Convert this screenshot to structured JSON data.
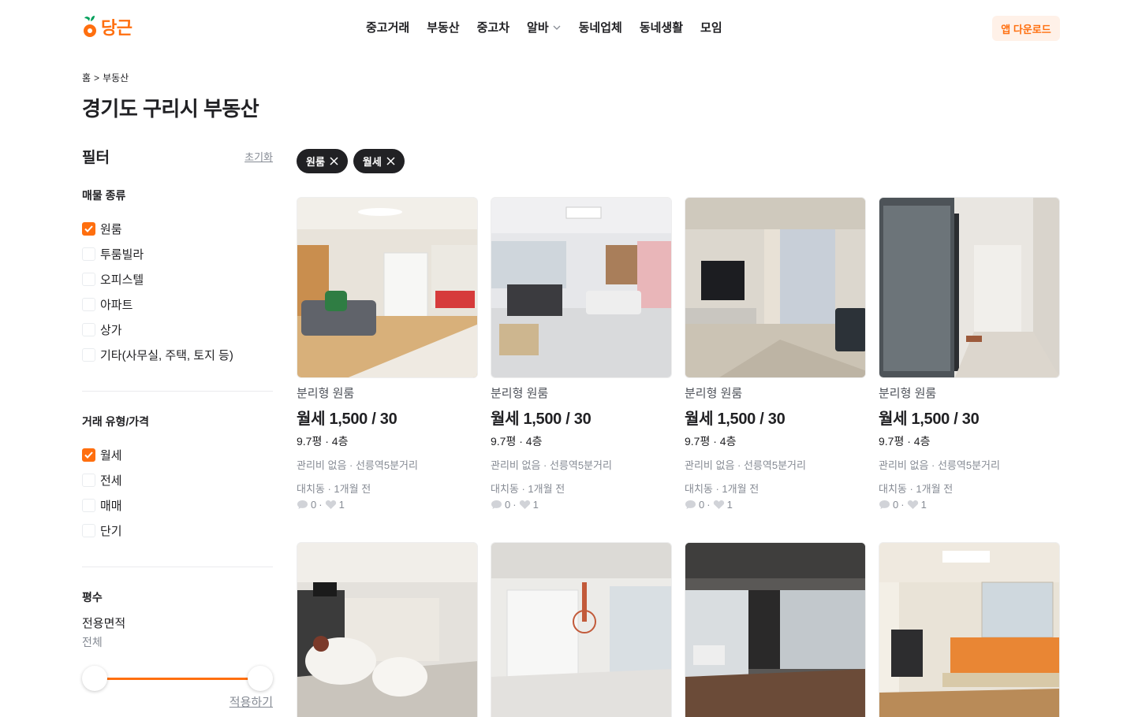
{
  "brand": {
    "name": "당근",
    "accent": "#ff6f0f"
  },
  "nav": {
    "items": [
      "중고거래",
      "부동산",
      "중고차",
      "알바",
      "동네업체",
      "동네생활",
      "모임"
    ],
    "app_download": "앱 다운로드"
  },
  "breadcrumb": {
    "home": "홈",
    "separator": ">",
    "current": "부동산"
  },
  "page_title": "경기도 구리시 부동산",
  "filters": {
    "title": "필터",
    "reset": "초기화",
    "property_type": {
      "title": "매물 종류",
      "options": [
        {
          "label": "원룸",
          "checked": true
        },
        {
          "label": "투룸빌라",
          "checked": false
        },
        {
          "label": "오피스텔",
          "checked": false
        },
        {
          "label": "아파트",
          "checked": false
        },
        {
          "label": "상가",
          "checked": false
        },
        {
          "label": "기타(사무실, 주택, 토지 등)",
          "checked": false
        }
      ]
    },
    "deal_type": {
      "title": "거래 유형/가격",
      "options": [
        {
          "label": "월세",
          "checked": true
        },
        {
          "label": "전세",
          "checked": false
        },
        {
          "label": "매매",
          "checked": false
        },
        {
          "label": "단기",
          "checked": false
        }
      ]
    },
    "area": {
      "title": "평수",
      "label": "전용면적",
      "value": "전체",
      "range": [
        0,
        1
      ]
    },
    "apply": "적용하기"
  },
  "chips": [
    "원룸",
    "월세"
  ],
  "listings": [
    {
      "type": "분리형 원룸",
      "price": "월세 1,500 / 30",
      "size": "9.7평 · 4층",
      "extra": "관리비 없음 · 선릉역5분거리",
      "location": "대치동 · 1개월 전",
      "chats": "0",
      "likes": "1",
      "photo": "living-room"
    },
    {
      "type": "분리형 원룸",
      "price": "월세 1,500 / 30",
      "size": "9.7평 · 4층",
      "extra": "관리비 없음 · 선릉역5분거리",
      "location": "대치동 · 1개월 전",
      "chats": "0",
      "likes": "1",
      "photo": "studio-desk"
    },
    {
      "type": "분리형 원룸",
      "price": "월세 1,500 / 30",
      "size": "9.7평 · 4층",
      "extra": "관리비 없음 · 선릉역5분거리",
      "location": "대치동 · 1개월 전",
      "chats": "0",
      "likes": "1",
      "photo": "tv-room"
    },
    {
      "type": "분리형 원룸",
      "price": "월세 1,500 / 30",
      "size": "9.7평 · 4층",
      "extra": "관리비 없음 · 선릉역5분거리",
      "location": "대치동 · 1개월 전",
      "chats": "0",
      "likes": "1",
      "photo": "glass-hallway"
    },
    {
      "photo": "lounge"
    },
    {
      "photo": "white-hall"
    },
    {
      "photo": "dark-office"
    },
    {
      "photo": "bedroom"
    }
  ]
}
